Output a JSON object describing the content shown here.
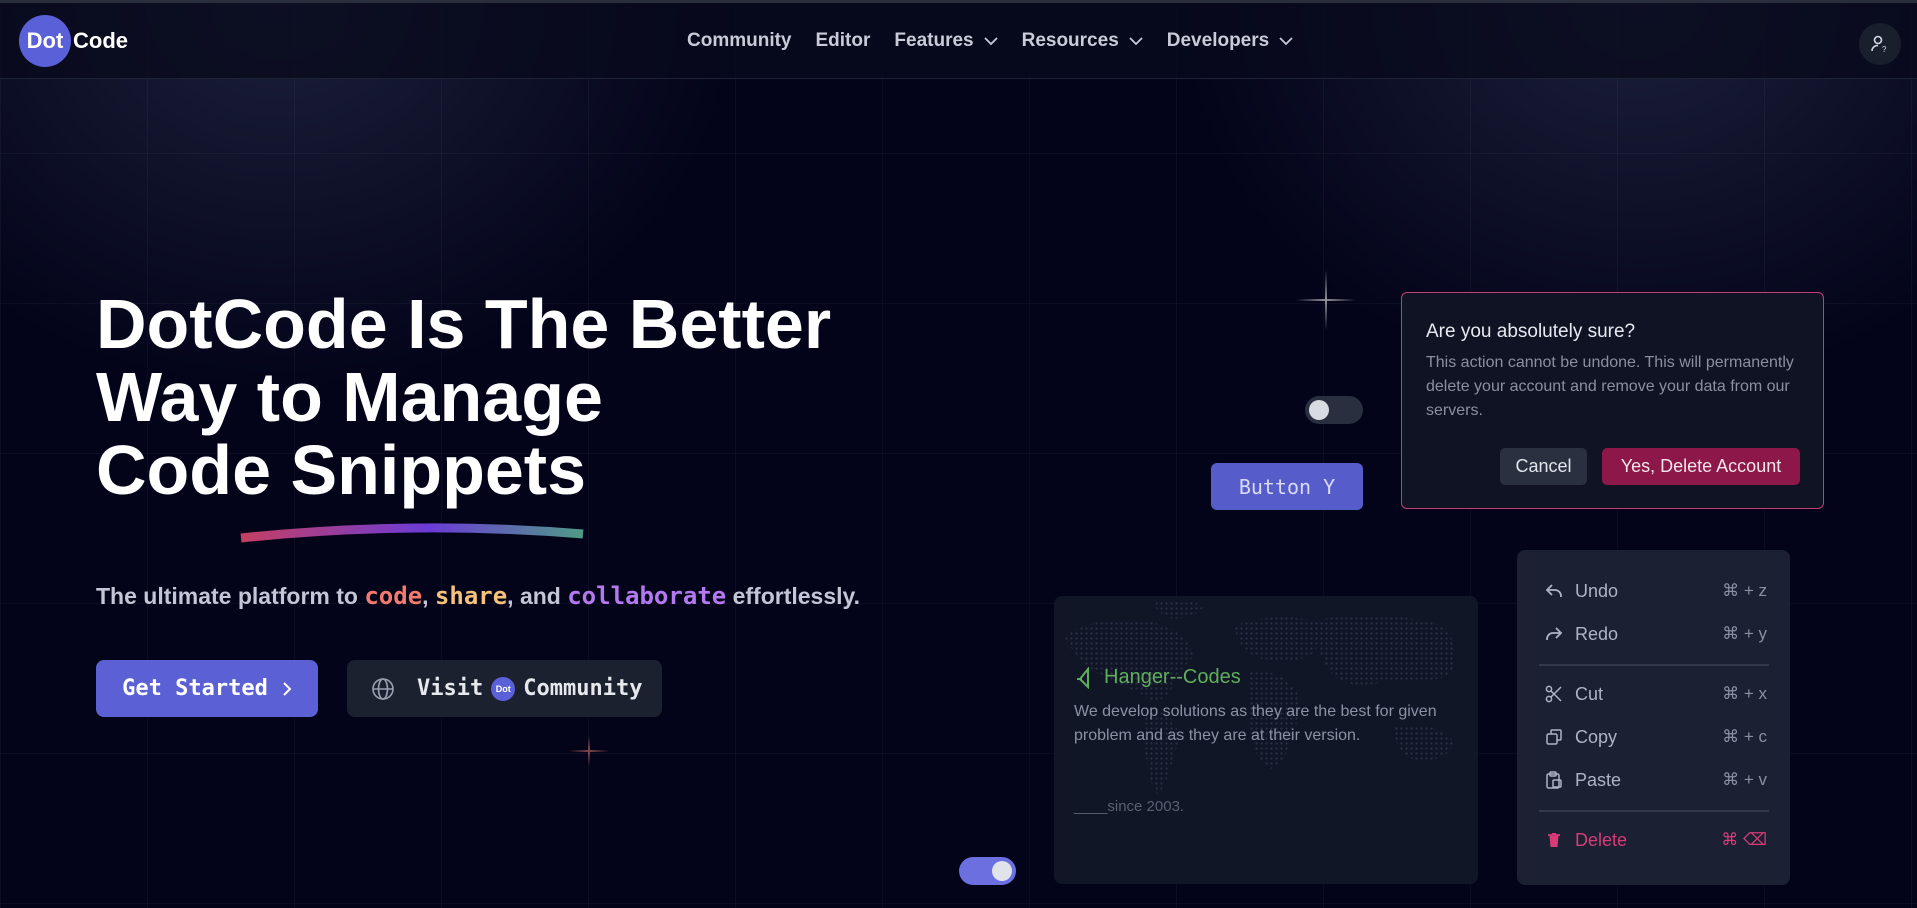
{
  "brand": {
    "logo_dot": "Dot",
    "logo_word": "Code"
  },
  "nav": {
    "items": [
      {
        "label": "Community",
        "dropdown": false
      },
      {
        "label": "Editor",
        "dropdown": false
      },
      {
        "label": "Features",
        "dropdown": true
      },
      {
        "label": "Resources",
        "dropdown": true
      },
      {
        "label": "Developers",
        "dropdown": true
      }
    ]
  },
  "hero": {
    "title_line1": "DotCode Is The Better",
    "title_line2": "Way to Manage",
    "title_line3": "Code Snippets",
    "sub_prefix": "The ultimate platform to ",
    "sub_word1": "code",
    "sub_comma": ", ",
    "sub_word2": "share",
    "sub_and": ", and ",
    "sub_word3": "collaborate",
    "sub_suffix": " effortlessly.",
    "cta_primary": "Get Started",
    "cta_secondary_prefix": "Visit",
    "cta_secondary_badge": "Dot",
    "cta_secondary_suffix": "Community"
  },
  "widgets": {
    "button_y": "Button Y",
    "toggle_top_on": false,
    "toggle_bottom_on": true
  },
  "dialog": {
    "title": "Are you absolutely sure?",
    "text": "This action cannot be undone. This will permanently delete your account and remove your data from our servers.",
    "cancel": "Cancel",
    "confirm": "Yes, Delete Account"
  },
  "context_menu": {
    "undo": {
      "label": "Undo",
      "shortcut": "⌘ + z",
      "icon": "undo-icon"
    },
    "redo": {
      "label": "Redo",
      "shortcut": "⌘ + y",
      "icon": "redo-icon"
    },
    "cut": {
      "label": "Cut",
      "shortcut": "⌘ + x",
      "icon": "scissors-icon"
    },
    "copy": {
      "label": "Copy",
      "shortcut": "⌘ + c",
      "icon": "copy-icon"
    },
    "paste": {
      "label": "Paste",
      "shortcut": "⌘ + v",
      "icon": "clipboard-icon"
    },
    "delete": {
      "label": "Delete",
      "shortcut": "⌘ ⌫",
      "icon": "trash-icon"
    }
  },
  "map_card": {
    "title": "Hanger--Codes",
    "text": "We develop solutions as they are the best for given problem and as they are at their version.",
    "since": "____since 2003."
  },
  "colors": {
    "accent": "#5b61d4",
    "danger": "#8d1748",
    "danger_text": "#d93b79",
    "green": "#5fae5c"
  }
}
